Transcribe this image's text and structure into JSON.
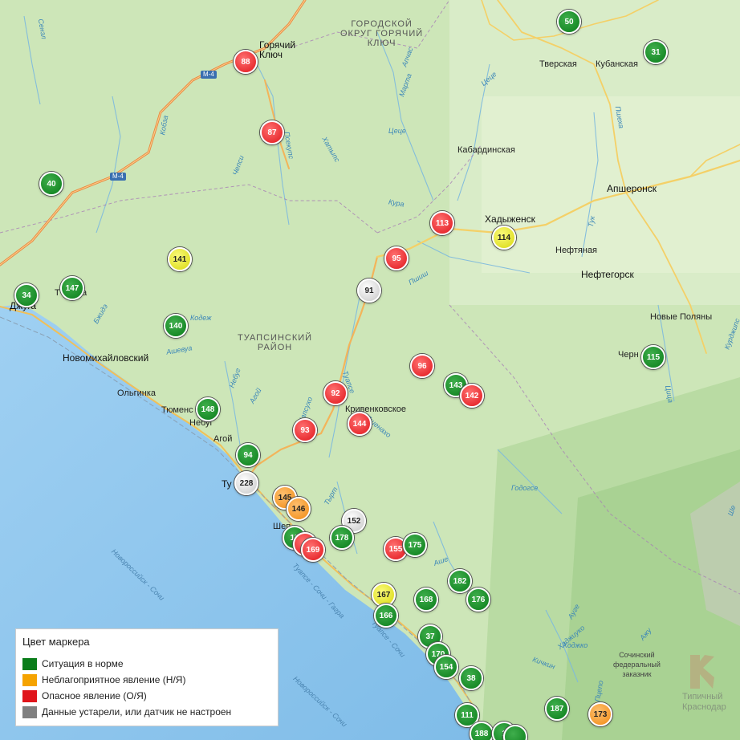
{
  "colors": {
    "normal": "#0a7d1a",
    "unfavorable": "#f08a12",
    "dangerous": "#e0151b",
    "stale": "#c6c6c6",
    "yellow": "#d8d80e"
  },
  "place_labels": [
    {
      "text": "Горячий\nКлюч",
      "cls": "city"
    },
    {
      "text": "ГОРОДСКОЙ\nОКРУГ ГОРЯЧИЙ\nКЛЮЧ",
      "cls": "district"
    },
    {
      "text": "Тверская",
      "cls": "town"
    },
    {
      "text": "Кубанская",
      "cls": "town"
    },
    {
      "text": "Кабардинская",
      "cls": "town"
    },
    {
      "text": "Апшеронск",
      "cls": "city"
    },
    {
      "text": "Хадыженск",
      "cls": "city"
    },
    {
      "text": "Нефтяная",
      "cls": "town"
    },
    {
      "text": "Нефтегорск",
      "cls": "city"
    },
    {
      "text": "Новые Поляны",
      "cls": "town"
    },
    {
      "text": "Черн",
      "cls": "town"
    },
    {
      "text": "Т",
      "cls": "town"
    },
    {
      "text": "ка",
      "cls": "town"
    },
    {
      "text": "Джуга",
      "cls": "city"
    },
    {
      "text": "Новомихайловский",
      "cls": "city"
    },
    {
      "text": "ТУАПСИНСКИЙ\nРАЙОН",
      "cls": "district"
    },
    {
      "text": "Ольгинка",
      "cls": "town"
    },
    {
      "text": "Тюменс",
      "cls": "town"
    },
    {
      "text": "Небуг",
      "cls": "town"
    },
    {
      "text": "Агой",
      "cls": "town"
    },
    {
      "text": "Кривенковское",
      "cls": "town"
    },
    {
      "text": "Ту",
      "cls": "city"
    },
    {
      "text": "Шеп",
      "cls": "town"
    },
    {
      "text": "Сочинский\nфедеральный\nзаказник",
      "cls": "reserve"
    }
  ],
  "river_labels": [
    "Хатыпс",
    "Цеце",
    "Пшиш",
    "Кура",
    "Цеце",
    "Апчас",
    "Марта",
    "Пшеха",
    "Тук",
    "Туапсе",
    "Пшенахо",
    "Небуг",
    "Агой",
    "Шапсухо",
    "Тырт",
    "Кобза",
    "Чепси",
    "Псекупс",
    "Кодеж",
    "Сензл",
    "Ашевуа",
    "Бжидэ",
    "Цица",
    "Курджипс",
    "Годогсе",
    "Ауге",
    "Кичкин",
    "Хаджиуко",
    "Ходжко",
    "Ажу",
    "Пцепо",
    "Ше",
    "Аше"
  ],
  "rail_labels": [
    "Новороссийск - Сочи",
    "Туапсе - Сочи - Гагра",
    "Новороссийск - Сочи",
    "Туапсе - Сочи"
  ],
  "road_shields": [
    "М-4",
    "М-4"
  ],
  "markers": [
    {
      "value": "88",
      "status": "dangerous"
    },
    {
      "value": "87",
      "status": "dangerous"
    },
    {
      "value": "50",
      "status": "normal"
    },
    {
      "value": "31",
      "status": "normal"
    },
    {
      "value": "40",
      "status": "normal"
    },
    {
      "value": "113",
      "status": "dangerous"
    },
    {
      "value": "114",
      "status": "yellow"
    },
    {
      "value": "95",
      "status": "dangerous"
    },
    {
      "value": "141",
      "status": "yellow"
    },
    {
      "value": "34",
      "status": "normal"
    },
    {
      "value": "147",
      "status": "normal"
    },
    {
      "value": "91",
      "status": "stale"
    },
    {
      "value": "140",
      "status": "normal"
    },
    {
      "value": "96",
      "status": "dangerous"
    },
    {
      "value": "115",
      "status": "normal"
    },
    {
      "value": "143",
      "status": "normal"
    },
    {
      "value": "142",
      "status": "dangerous"
    },
    {
      "value": "92",
      "status": "dangerous"
    },
    {
      "value": "148",
      "status": "normal"
    },
    {
      "value": "144",
      "status": "dangerous"
    },
    {
      "value": "93",
      "status": "dangerous"
    },
    {
      "value": "94",
      "status": "normal"
    },
    {
      "value": "228",
      "status": "stale"
    },
    {
      "value": "145",
      "status": "unfavorable"
    },
    {
      "value": "146",
      "status": "unfavorable"
    },
    {
      "value": "152",
      "status": "stale"
    },
    {
      "value": "15",
      "status": "normal"
    },
    {
      "value": "1",
      "status": "dangerous"
    },
    {
      "value": "169",
      "status": "dangerous"
    },
    {
      "value": "178",
      "status": "normal"
    },
    {
      "value": "155",
      "status": "dangerous"
    },
    {
      "value": "175",
      "status": "normal"
    },
    {
      "value": "182",
      "status": "normal"
    },
    {
      "value": "167",
      "status": "yellow"
    },
    {
      "value": "168",
      "status": "normal"
    },
    {
      "value": "176",
      "status": "normal"
    },
    {
      "value": "166",
      "status": "normal"
    },
    {
      "value": "37",
      "status": "normal"
    },
    {
      "value": "170",
      "status": "normal"
    },
    {
      "value": "154",
      "status": "normal"
    },
    {
      "value": "38",
      "status": "normal"
    },
    {
      "value": "111",
      "status": "normal"
    },
    {
      "value": "187",
      "status": "normal"
    },
    {
      "value": "173",
      "status": "unfavorable"
    },
    {
      "value": "188",
      "status": "normal"
    },
    {
      "value": "1",
      "status": "normal"
    },
    {
      "value": "",
      "status": "normal"
    }
  ],
  "legend": {
    "title": "Цвет маркера",
    "items": [
      {
        "label": "Ситуация в норме",
        "color": "#0a7d1a"
      },
      {
        "label": "Неблагоприятное явление (Н/Я)",
        "color": "#f5a300"
      },
      {
        "label": "Опасное явление (О/Я)",
        "color": "#e0151b"
      },
      {
        "label": "Данные устарели, или датчик не настроен",
        "color": "#808080"
      }
    ]
  },
  "watermark": "Типичный\nКраснодар"
}
